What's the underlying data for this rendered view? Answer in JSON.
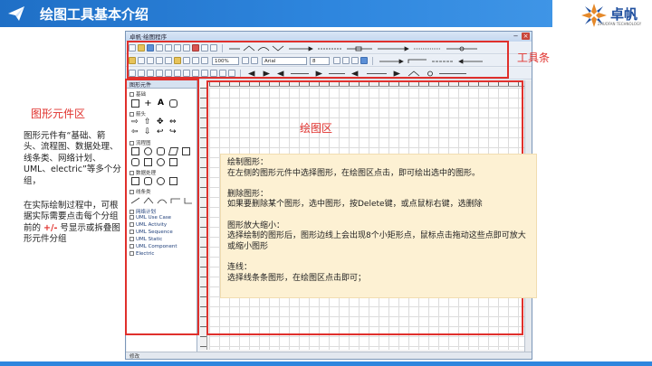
{
  "header": {
    "title": "绘图工具基本介绍",
    "logo_text": "卓帆",
    "logo_sub": "ZHUOFAN TECHNOLOGY",
    "colors": {
      "bar": "#2e86de",
      "logo": "#1f4f9f",
      "accent_red": "#e0302c"
    }
  },
  "labels": {
    "elements": "图形元件区",
    "toolbar": "工具条",
    "canvas": "绘图区"
  },
  "left_desc": {
    "para1": "图形元件有“基础、箭头、流程图、数据处理、线条类、网络计划、UML、electric”等多个分组，",
    "para2_a": "在实际绘制过程中，可根据实际需要点击每个分组前的 ",
    "para2_sign": "+/-",
    "para2_b": " 号显示或拆叠图形元件分组"
  },
  "app": {
    "title": "卓帆·绘图程序",
    "font_size": "100%",
    "font_name": "Arial",
    "font_pt": "8",
    "status": "修改"
  },
  "panel": {
    "title": "图形元件",
    "categories": [
      "基础",
      "箭头",
      "流程图",
      "数据处理",
      "线条类"
    ],
    "groups": [
      "网络计划",
      "UML Use Case",
      "UML Activity",
      "UML Sequence",
      "UML Static",
      "UML Component",
      "Electric"
    ]
  },
  "info": {
    "draw_title": "绘制图形：",
    "draw_text": "在左侧的图形元件中选择图形，在绘图区点击，即可绘出选中的图形。",
    "delete_title": "删除图形：",
    "delete_text": "如果要删除某个图形，选中图形，按Delete键，或点鼠标右键，选删除",
    "zoom_title": "图形放大缩小：",
    "zoom_text": "选择绘制的图形后，图形边线上会出现8个小矩形点，鼠标点击拖动这些点即可放大或缩小图形",
    "line_title": "连线：",
    "line_text": "选择线条条图形，在绘图区点击即可；"
  }
}
